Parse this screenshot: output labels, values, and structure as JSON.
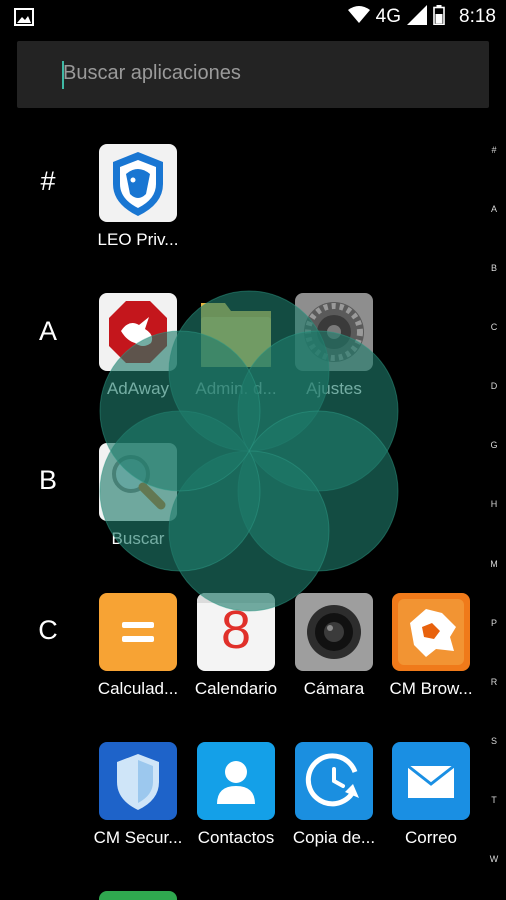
{
  "status_bar": {
    "network": "4G",
    "time": "8:18"
  },
  "search": {
    "placeholder": "Buscar aplicaciones"
  },
  "alphabet_index": [
    "#",
    "A",
    "B",
    "C",
    "D",
    "G",
    "H",
    "M",
    "P",
    "R",
    "S",
    "T",
    "W"
  ],
  "sections": {
    "hash": "#",
    "a": "A",
    "b": "B",
    "c": "C"
  },
  "apps": {
    "leo": "LEO Priv...",
    "adaway": "AdAway",
    "admin": "Admin. d...",
    "ajustes": "Ajustes",
    "buscar": "Buscar",
    "calculadora": "Calculad...",
    "calendario": "Calendario",
    "calendario_day": "8",
    "camara": "Cámara",
    "cm_browser": "CM Brow...",
    "cm_security": "CM Secur...",
    "contactos": "Contactos",
    "copia": "Copia de...",
    "correo": "Correo"
  },
  "colors": {
    "background": "#000000",
    "search_bg": "#232323",
    "accent": "#3fb9a5",
    "flower": "#1f7a6a"
  }
}
